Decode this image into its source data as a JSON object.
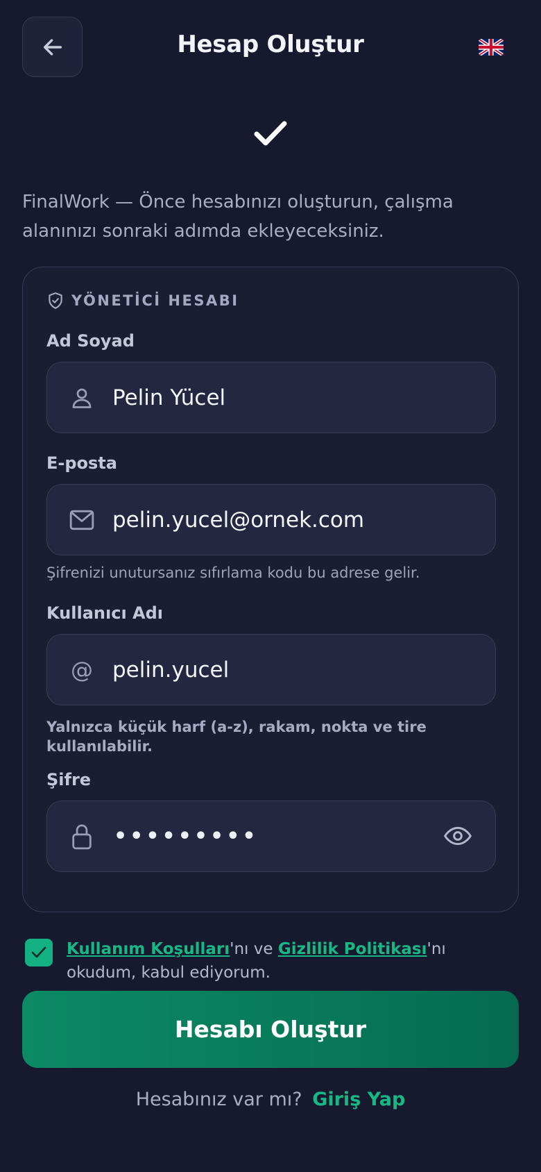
{
  "header": {
    "back_icon": "arrow-left-icon",
    "title": "Hesap Oluştur",
    "language_icon": "uk-flag-icon"
  },
  "logo_icon": "checkmark-icon",
  "intro": "FinalWork — Önce hesabınızı oluşturun, çalışma alanınızı sonraki adımda ekleyeceksiniz.",
  "card": {
    "section_icon": "shield-check-icon",
    "section_title": "YÖNETİCİ HESABI",
    "fields": {
      "name": {
        "label": "Ad Soyad",
        "icon": "user-icon",
        "value": "Pelin Yücel"
      },
      "email": {
        "label": "E-posta",
        "icon": "mail-icon",
        "value": "pelin.yucel@ornek.com",
        "hint": "Şifrenizi unutursanız sıfırlama kodu bu adrese gelir."
      },
      "username": {
        "label": "Kullanıcı Adı",
        "icon": "at-icon",
        "value": "pelin.yucel",
        "hint": "Yalnızca küçük harf (a-z), rakam, nokta ve tire kullanılabilir."
      },
      "password": {
        "label": "Şifre",
        "icon": "lock-icon",
        "masked_value": "•••••••••",
        "toggle_icon": "eye-icon"
      }
    }
  },
  "terms": {
    "checked": true,
    "terms_link": "Kullanım Koşulları",
    "and_text": "'nı ve ",
    "privacy_link": "Gizlilik Politikası",
    "suffix": "'nı okudum, kabul ediyorum."
  },
  "submit_label": "Hesabı Oluştur",
  "footer": {
    "question": "Hesabınız var mı?",
    "login_label": "Giriş Yap"
  },
  "colors": {
    "background": "#171a2e",
    "card": "#1b1e33",
    "input": "#24273f",
    "accent": "#18b884",
    "button": "#0b8a64"
  }
}
